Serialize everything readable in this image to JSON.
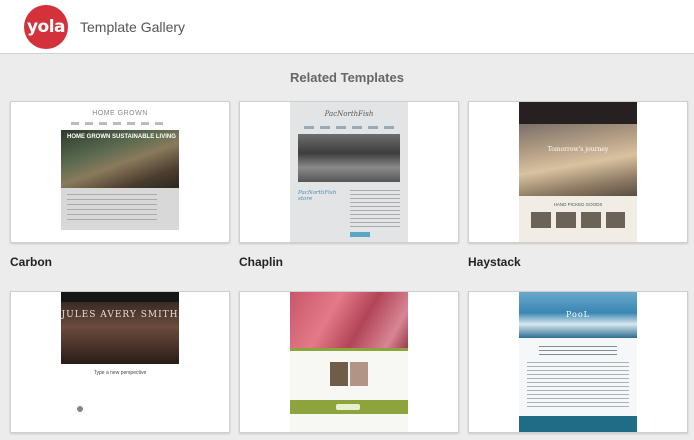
{
  "header": {
    "logo_text": "yola",
    "title": "Template Gallery"
  },
  "section": {
    "title": "Related Templates"
  },
  "templates": [
    {
      "name": "Carbon",
      "preview": {
        "brand": "HOME GROWN",
        "hero_text": "HOME GROWN SUSTAINABLE LIVING"
      }
    },
    {
      "name": "Chaplin",
      "preview": {
        "brand": "PacNorthFish",
        "script": "PacNorthFish store"
      }
    },
    {
      "name": "Haystack",
      "preview": {
        "tagline": "Tomorrow's journey",
        "subtitle": "HAND PICKED GOODS"
      }
    },
    {
      "name": "",
      "preview": {
        "name_art": "JULES AVERY SMITH",
        "tagline": "Type a new perspective"
      }
    },
    {
      "name": "",
      "preview": {}
    },
    {
      "name": "",
      "preview": {
        "logo": "PooL"
      }
    }
  ],
  "colors": {
    "brand_red": "#d3323a",
    "page_bg": "#ececec"
  }
}
